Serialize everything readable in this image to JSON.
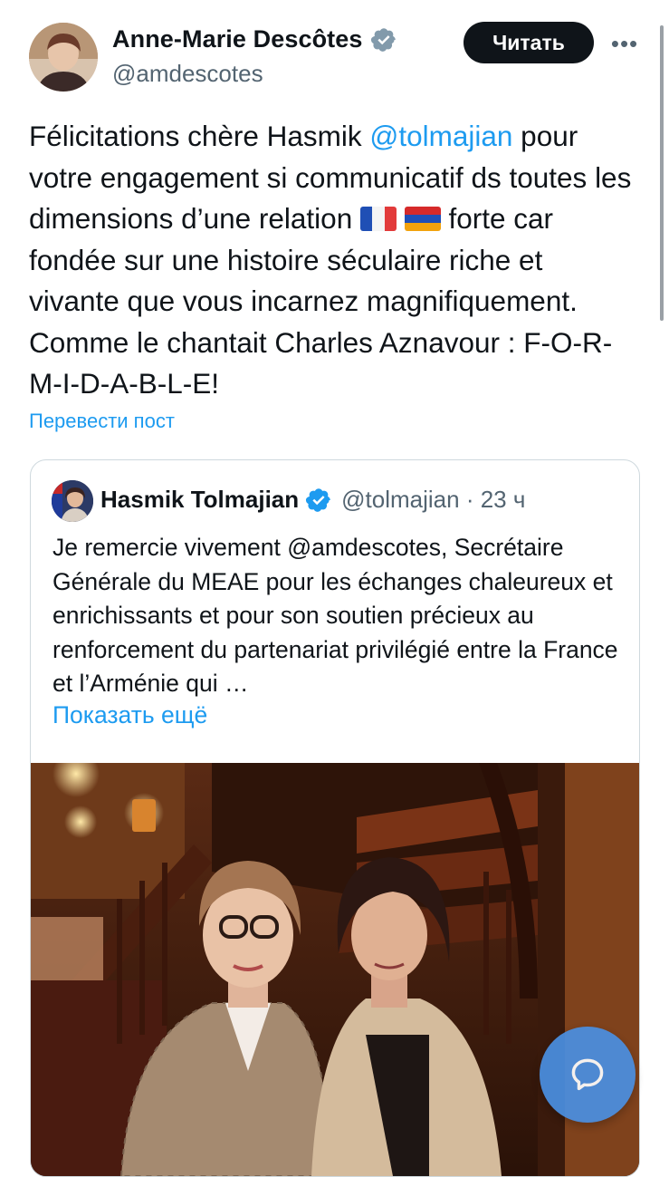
{
  "author": {
    "name": "Anne-Marie Descôtes",
    "handle": "@amdescotes",
    "verified_icon": "verified-badge-icon"
  },
  "actions": {
    "follow_label": "Читать",
    "more_label": "•••"
  },
  "tweet": {
    "part1": "Félicitations chère Hasmik ",
    "mention": "@tolmajian",
    "part2": " pour votre engagement si communicatif ds toutes les dimensions d’une relation ",
    "flags": [
      "flag-france",
      "flag-armenia"
    ],
    "part3": " forte car fondée sur une histoire séculaire riche et vivante que vous incarnez magnifiquement. Comme le chantait Charles Aznavour : F-O-R-M-I-D-A-B-L-E!"
  },
  "translate_label": "Перевести пост",
  "quoted": {
    "name": "Hasmik Tolmajian",
    "handle_time": "@tolmajian · 23 ч",
    "text": "Je remercie vivement @amdescotes, Secrétaire Générale du MEAE pour les échanges chaleureux et enrichissants et pour son soutien précieux au renforcement du partenariat privilégié entre la France et l’Arménie qui …",
    "show_more_label": "Показать ещё"
  },
  "colors": {
    "accent": "#1d9bf0",
    "text": "#0f1419",
    "secondary": "#536471",
    "verified": "#1d9bf0",
    "fab": "#4a90e2"
  }
}
